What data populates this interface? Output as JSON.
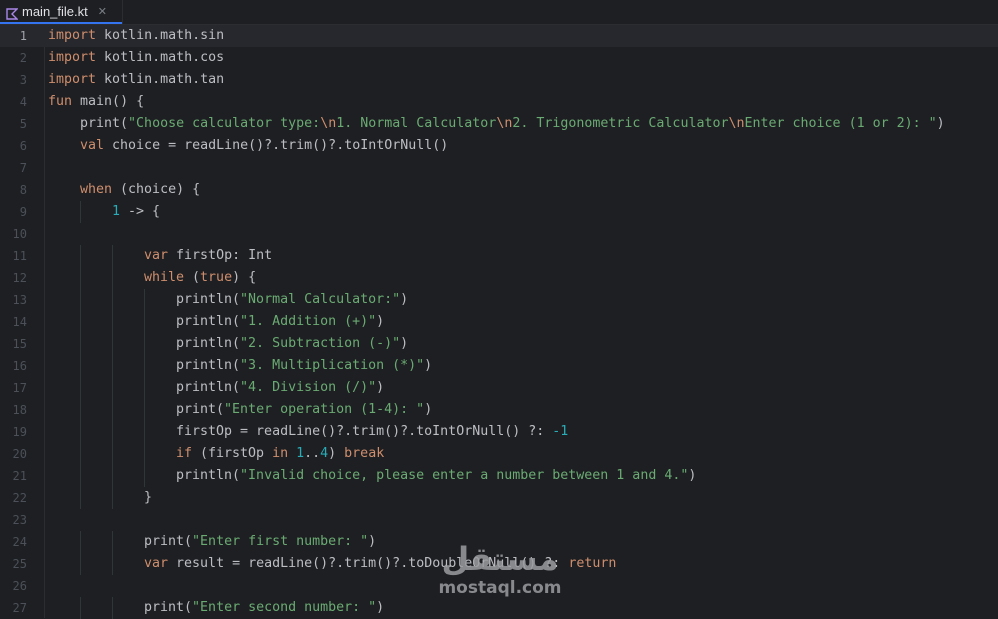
{
  "tab": {
    "filename": "main_file.kt",
    "icon": "kotlin-file-icon",
    "close_icon": "close-icon"
  },
  "lines": [
    {
      "n": "1",
      "indent": 0,
      "tokens": [
        [
          "kw",
          "import"
        ],
        [
          "t",
          " kotlin.math.sin"
        ]
      ]
    },
    {
      "n": "2",
      "indent": 0,
      "tokens": [
        [
          "kw",
          "import"
        ],
        [
          "t",
          " kotlin.math.cos"
        ]
      ]
    },
    {
      "n": "3",
      "indent": 0,
      "tokens": [
        [
          "kw",
          "import"
        ],
        [
          "t",
          " kotlin.math.tan"
        ]
      ]
    },
    {
      "n": "4",
      "indent": 0,
      "tokens": [
        [
          "kw",
          "fun"
        ],
        [
          "t",
          " main() {"
        ]
      ]
    },
    {
      "n": "5",
      "indent": 1,
      "tokens": [
        [
          "t",
          "print("
        ],
        [
          "str",
          "\"Choose calculator type:"
        ],
        [
          "esc",
          "\\n"
        ],
        [
          "str",
          "1. Normal Calculator"
        ],
        [
          "esc",
          "\\n"
        ],
        [
          "str",
          "2. Trigonometric Calculator"
        ],
        [
          "esc",
          "\\n"
        ],
        [
          "str",
          "Enter choice (1 or 2): \""
        ],
        [
          "t",
          ")"
        ]
      ]
    },
    {
      "n": "6",
      "indent": 1,
      "tokens": [
        [
          "kw",
          "val"
        ],
        [
          "t",
          " choice = readLine()?.trim()?.toIntOrNull()"
        ]
      ]
    },
    {
      "n": "7",
      "indent": 0,
      "tokens": []
    },
    {
      "n": "8",
      "indent": 1,
      "tokens": [
        [
          "kw",
          "when"
        ],
        [
          "t",
          " (choice) {"
        ]
      ]
    },
    {
      "n": "9",
      "indent": 2,
      "tokens": [
        [
          "num",
          "1"
        ],
        [
          "t",
          " -> {"
        ]
      ]
    },
    {
      "n": "10",
      "indent": 0,
      "tokens": []
    },
    {
      "n": "11",
      "indent": 3,
      "tokens": [
        [
          "kw",
          "var"
        ],
        [
          "t",
          " firstOp: Int"
        ]
      ]
    },
    {
      "n": "12",
      "indent": 3,
      "tokens": [
        [
          "kw",
          "while"
        ],
        [
          "t",
          " ("
        ],
        [
          "kw",
          "true"
        ],
        [
          "t",
          ") {"
        ]
      ]
    },
    {
      "n": "13",
      "indent": 4,
      "tokens": [
        [
          "t",
          "println("
        ],
        [
          "str",
          "\"Normal Calculator:\""
        ],
        [
          "t",
          ")"
        ]
      ]
    },
    {
      "n": "14",
      "indent": 4,
      "tokens": [
        [
          "t",
          "println("
        ],
        [
          "str",
          "\"1. Addition (+)\""
        ],
        [
          "t",
          ")"
        ]
      ]
    },
    {
      "n": "15",
      "indent": 4,
      "tokens": [
        [
          "t",
          "println("
        ],
        [
          "str",
          "\"2. Subtraction (-)\""
        ],
        [
          "t",
          ")"
        ]
      ]
    },
    {
      "n": "16",
      "indent": 4,
      "tokens": [
        [
          "t",
          "println("
        ],
        [
          "str",
          "\"3. Multiplication (*)\""
        ],
        [
          "t",
          ")"
        ]
      ]
    },
    {
      "n": "17",
      "indent": 4,
      "tokens": [
        [
          "t",
          "println("
        ],
        [
          "str",
          "\"4. Division (/)\""
        ],
        [
          "t",
          ")"
        ]
      ]
    },
    {
      "n": "18",
      "indent": 4,
      "tokens": [
        [
          "t",
          "print("
        ],
        [
          "str",
          "\"Enter operation (1-4): \""
        ],
        [
          "t",
          ")"
        ]
      ]
    },
    {
      "n": "19",
      "indent": 4,
      "tokens": [
        [
          "t",
          "firstOp = readLine()?.trim()?.toIntOrNull() ?: "
        ],
        [
          "num",
          "-1"
        ]
      ]
    },
    {
      "n": "20",
      "indent": 4,
      "tokens": [
        [
          "kw",
          "if"
        ],
        [
          "t",
          " (firstOp "
        ],
        [
          "kw",
          "in"
        ],
        [
          "t",
          " "
        ],
        [
          "num",
          "1"
        ],
        [
          "t",
          ".."
        ],
        [
          "num",
          "4"
        ],
        [
          "t",
          ") "
        ],
        [
          "kw",
          "break"
        ]
      ]
    },
    {
      "n": "21",
      "indent": 4,
      "tokens": [
        [
          "t",
          "println("
        ],
        [
          "str",
          "\"Invalid choice, please enter a number between 1 and 4.\""
        ],
        [
          "t",
          ")"
        ]
      ]
    },
    {
      "n": "22",
      "indent": 3,
      "tokens": [
        [
          "t",
          "}"
        ]
      ]
    },
    {
      "n": "23",
      "indent": 0,
      "tokens": []
    },
    {
      "n": "24",
      "indent": 3,
      "tokens": [
        [
          "t",
          "print("
        ],
        [
          "str",
          "\"Enter first number: \""
        ],
        [
          "t",
          ")"
        ]
      ]
    },
    {
      "n": "25",
      "indent": 3,
      "tokens": [
        [
          "kw",
          "var"
        ],
        [
          "t",
          " result = readLine()?.trim()?.toDoubleOrNull() ?: "
        ],
        [
          "kw",
          "return"
        ]
      ]
    },
    {
      "n": "26",
      "indent": 0,
      "tokens": []
    },
    {
      "n": "27",
      "indent": 3,
      "tokens": [
        [
          "t",
          "print("
        ],
        [
          "str",
          "\"Enter second number: \""
        ],
        [
          "t",
          ")"
        ]
      ]
    }
  ],
  "current_line": "1",
  "watermark": {
    "arabic": "مستقل",
    "latin": "mostaql.com"
  }
}
